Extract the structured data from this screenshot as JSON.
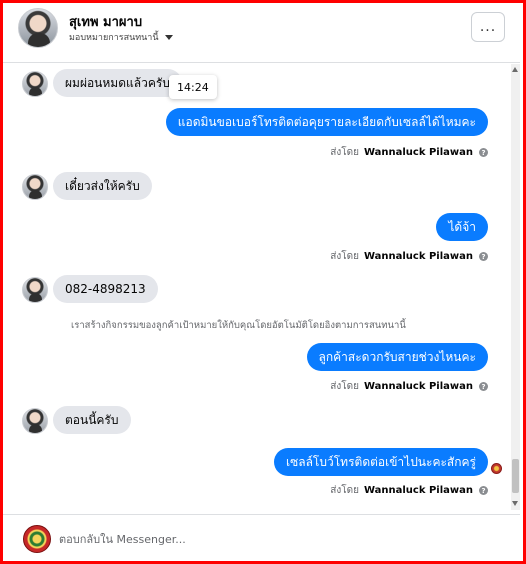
{
  "header": {
    "name": "สุเทพ มาผาบ",
    "assign_label": "มอบหมายการสนทนานี้",
    "more_icon": "..."
  },
  "conversation": {
    "tooltip_time": "14:24",
    "sent_by_prefix": "ส่งโดย",
    "help_icon": "?",
    "messages": [
      {
        "from": "customer",
        "text": "ผมผ่อนหมดแล้วครับ"
      },
      {
        "from": "page",
        "text": "แอดมินขอเบอร์โทรติดต่อคุยรายละเอียดกับเซลล์ได้ไหมคะ",
        "sent_by": "Wannaluck Pilawan"
      },
      {
        "from": "customer",
        "text": "เดี๋ยวส่งให้ครับ"
      },
      {
        "from": "page",
        "text": "ได้จ้า",
        "sent_by": "Wannaluck Pilawan"
      },
      {
        "from": "customer",
        "text": "082-4898213"
      },
      {
        "from": "system",
        "text": "เราสร้างกิจกรรมของลูกค้าเป้าหมายให้กับคุณโดยอัตโนมัติโดยอิงตามการสนทนานี้"
      },
      {
        "from": "page",
        "text": "ลูกค้าสะดวกรับสายช่วงไหนคะ",
        "sent_by": "Wannaluck Pilawan"
      },
      {
        "from": "customer",
        "text": "ตอนนี้ครับ"
      },
      {
        "from": "page",
        "text": "เซลล์โบว์โทรติดต่อเข้าไปนะคะสักครู่",
        "sent_by": "Wannaluck Pilawan"
      }
    ]
  },
  "footer": {
    "reply_placeholder": "ตอบกลับใน Messenger..."
  },
  "colors": {
    "outgoing_bubble": "#0a7cff",
    "incoming_bubble": "#e4e6eb",
    "frame_border": "#ff0000"
  }
}
